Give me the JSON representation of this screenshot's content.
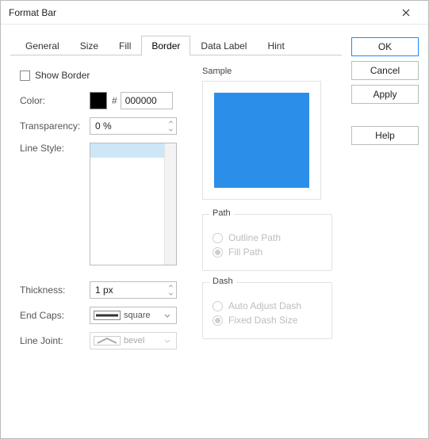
{
  "window": {
    "title": "Format Bar"
  },
  "tabs": [
    "General",
    "Size",
    "Fill",
    "Border",
    "Data Label",
    "Hint"
  ],
  "active_tab_index": 3,
  "buttons": {
    "ok": "OK",
    "cancel": "Cancel",
    "apply": "Apply",
    "help": "Help"
  },
  "border": {
    "show_border_label": "Show Border",
    "color_label": "Color:",
    "color_hex": "000000",
    "transparency_label": "Transparency:",
    "transparency_value": "0 %",
    "line_style_label": "Line Style:",
    "thickness_label": "Thickness:",
    "thickness_value": "1 px",
    "end_caps_label": "End Caps:",
    "end_caps_value": "square",
    "line_joint_label": "Line Joint:",
    "line_joint_value": "bevel"
  },
  "sample": {
    "label": "Sample",
    "color": "#2b8fe9"
  },
  "path": {
    "title": "Path",
    "outline": "Outline Path",
    "fill": "Fill Path",
    "selected": "fill"
  },
  "dash": {
    "title": "Dash",
    "auto": "Auto Adjust Dash",
    "fixed": "Fixed Dash Size",
    "selected": "fixed"
  }
}
